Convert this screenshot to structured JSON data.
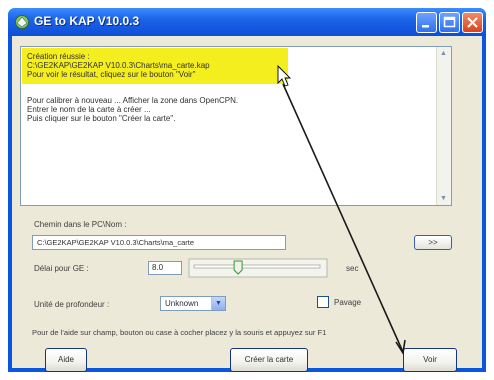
{
  "window": {
    "title": "GE to KAP V10.0.3",
    "colors": {
      "titlebar": "#1d63e8",
      "client": "#ece9d8",
      "highlight": "#f4ee1e",
      "close": "#d9421a"
    }
  },
  "titlebar_buttons": {
    "minimize_icon": "minimize-icon",
    "maximize_icon": "maximize-icon",
    "close_icon": "close-icon"
  },
  "memo": {
    "lines": [
      "Création réussie :",
      "C:\\GE2KAP\\GE2KAP V10.0.3\\Charts\\ma_carte.kap",
      "Pour voir le résultat, cliquez sur le bouton \"Voir\"",
      "",
      "Pour calibrer à nouveau ... Afficher la zone dans OpenCPN.",
      "Entrer le nom de la carte à créer ...",
      "Puis cliquer sur le bouton \"Créer la carte\"."
    ]
  },
  "path": {
    "label": "Chemin dans le PC\\Nom :",
    "value": "C:\\GE2KAP\\GE2KAP V10.0.3\\Charts\\ma_carte",
    "browse_label": ">>"
  },
  "delay": {
    "label": "Délai pour GE :",
    "value": "8.0",
    "unit": "sec",
    "slider_level": 0.35
  },
  "depth": {
    "label": "Unité de profondeur :",
    "selected": "Unknown"
  },
  "pavage": {
    "label": "Pavage",
    "checked": false
  },
  "help_text": "Pour de l'aide sur champ, bouton ou case à cocher placez y la souris et appuyez sur F1",
  "buttons": {
    "aide": "Aide",
    "creer": "Créer la carte",
    "voir": "Voir"
  }
}
